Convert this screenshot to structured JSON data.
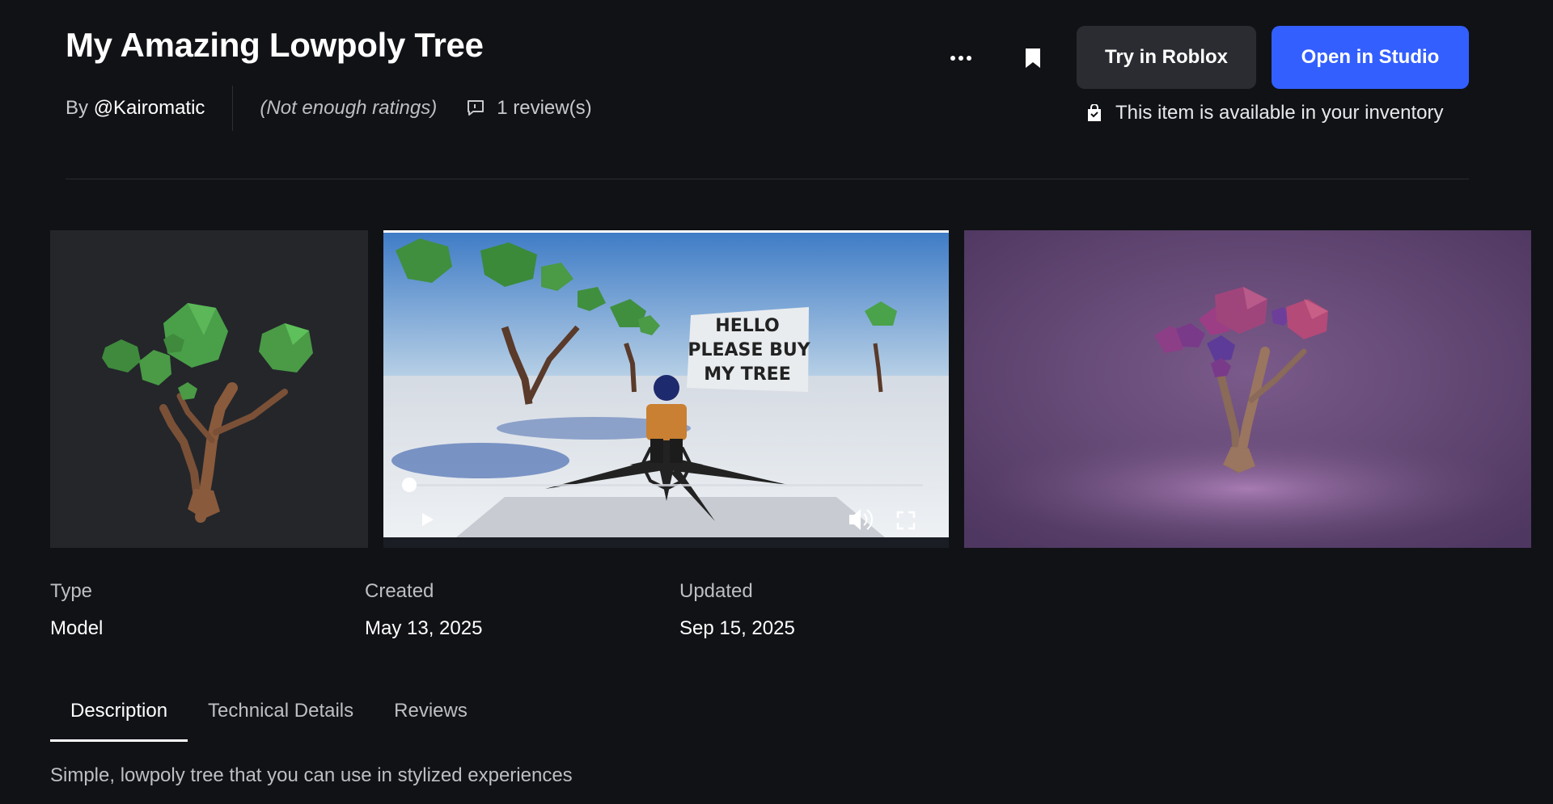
{
  "item": {
    "title": "My Amazing Lowpoly Tree",
    "by_prefix": "By",
    "creator": "@Kairomatic",
    "ratings": "(Not enough ratings)",
    "reviews": "1 review(s)"
  },
  "actions": {
    "more_icon": "ellipsis-icon",
    "bookmark_icon": "bookmark-icon",
    "try_label": "Try in Roblox",
    "studio_label": "Open in Studio",
    "inventory_text": "This item is available in your inventory"
  },
  "media": {
    "video_sign_lines": [
      "HELLO",
      "PLEASE BUY",
      "MY TREE"
    ],
    "video_progress": 0.01
  },
  "details": {
    "type_label": "Type",
    "type_value": "Model",
    "created_label": "Created",
    "created_value": "May 13, 2025",
    "updated_label": "Updated",
    "updated_value": "Sep 15, 2025"
  },
  "tabs": [
    {
      "label": "Description",
      "active": true
    },
    {
      "label": "Technical Details",
      "active": false
    },
    {
      "label": "Reviews",
      "active": false
    }
  ],
  "description": "Simple, lowpoly tree that you can use in stylized experiences",
  "colors": {
    "background": "#111216",
    "primary_button": "#335fff",
    "secondary_button": "#2a2c31"
  }
}
